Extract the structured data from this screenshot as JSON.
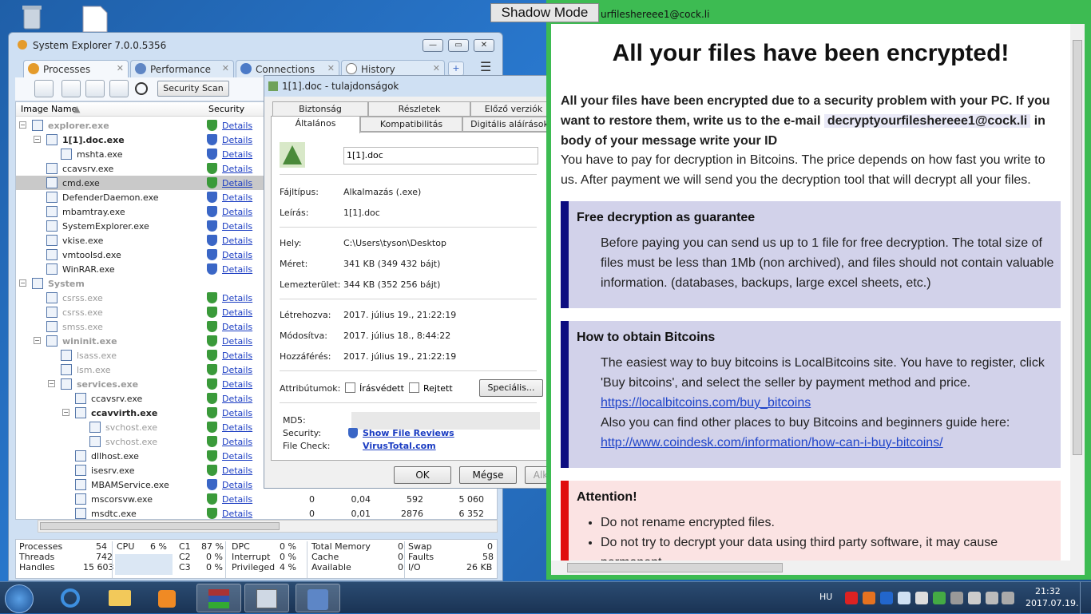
{
  "system_explorer": {
    "title": "System Explorer 7.0.0.5356",
    "tabs": [
      "Processes",
      "Performance",
      "Connections",
      "History"
    ],
    "security_scan": "Security Scan",
    "columns": {
      "image_name": "Image Name",
      "security": "Security"
    },
    "details_label": "Details",
    "processes": [
      {
        "name": "explorer.exe",
        "style": "grey-bold",
        "indent": 0,
        "tree": "−",
        "shield": "green"
      },
      {
        "name": "1[1].doc.exe",
        "style": "bold",
        "indent": 1,
        "tree": "−",
        "shield": "blue"
      },
      {
        "name": "mshta.exe",
        "style": "normal",
        "indent": 2,
        "tree": "",
        "shield": "blue"
      },
      {
        "name": "ccavsrv.exe",
        "style": "normal",
        "indent": 1,
        "tree": "",
        "shield": "green"
      },
      {
        "name": "cmd.exe",
        "style": "normal",
        "indent": 1,
        "tree": "",
        "shield": "green",
        "selected": true
      },
      {
        "name": "DefenderDaemon.exe",
        "style": "normal",
        "indent": 1,
        "tree": "",
        "shield": "blue"
      },
      {
        "name": "mbamtray.exe",
        "style": "normal",
        "indent": 1,
        "tree": "",
        "shield": "blue"
      },
      {
        "name": "SystemExplorer.exe",
        "style": "normal",
        "indent": 1,
        "tree": "",
        "shield": "blue"
      },
      {
        "name": "vkise.exe",
        "style": "normal",
        "indent": 1,
        "tree": "",
        "shield": "blue"
      },
      {
        "name": "vmtoolsd.exe",
        "style": "normal",
        "indent": 1,
        "tree": "",
        "shield": "blue"
      },
      {
        "name": "WinRAR.exe",
        "style": "normal",
        "indent": 1,
        "tree": "",
        "shield": "blue"
      },
      {
        "name": "System",
        "style": "grey-bold",
        "indent": 0,
        "tree": "−",
        "shield": ""
      },
      {
        "name": "csrss.exe",
        "style": "grey",
        "indent": 1,
        "tree": "",
        "shield": "green"
      },
      {
        "name": "csrss.exe",
        "style": "grey",
        "indent": 1,
        "tree": "",
        "shield": "green"
      },
      {
        "name": "smss.exe",
        "style": "grey",
        "indent": 1,
        "tree": "",
        "shield": "green"
      },
      {
        "name": "wininit.exe",
        "style": "grey-bold",
        "indent": 1,
        "tree": "−",
        "shield": "green"
      },
      {
        "name": "lsass.exe",
        "style": "grey",
        "indent": 2,
        "tree": "",
        "shield": "green"
      },
      {
        "name": "lsm.exe",
        "style": "grey",
        "indent": 2,
        "tree": "",
        "shield": "green"
      },
      {
        "name": "services.exe",
        "style": "grey-bold",
        "indent": 2,
        "tree": "−",
        "shield": "green"
      },
      {
        "name": "ccavsrv.exe",
        "style": "normal",
        "indent": 3,
        "tree": "",
        "shield": "green"
      },
      {
        "name": "ccavvirth.exe",
        "style": "bold",
        "indent": 3,
        "tree": "−",
        "shield": "green"
      },
      {
        "name": "svchost.exe",
        "style": "grey",
        "indent": 4,
        "tree": "",
        "shield": "green"
      },
      {
        "name": "svchost.exe",
        "style": "grey",
        "indent": 4,
        "tree": "",
        "shield": "green"
      },
      {
        "name": "dllhost.exe",
        "style": "normal",
        "indent": 3,
        "tree": "",
        "shield": "green"
      },
      {
        "name": "isesrv.exe",
        "style": "normal",
        "indent": 3,
        "tree": "",
        "shield": "green"
      },
      {
        "name": "MBAMService.exe",
        "style": "normal",
        "indent": 3,
        "tree": "",
        "shield": "blue"
      },
      {
        "name": "mscorsvw.exe",
        "style": "normal",
        "indent": 3,
        "tree": "",
        "shield": "green",
        "cols": [
          "0",
          "0,04",
          "592",
          "5 060"
        ]
      },
      {
        "name": "msdtc.exe",
        "style": "normal",
        "indent": 3,
        "tree": "",
        "shield": "green",
        "cols": [
          "0",
          "0,01",
          "2876",
          "6 352"
        ]
      }
    ],
    "status": {
      "processes_label": "Processes",
      "processes": "54",
      "threads_label": "Threads",
      "threads": "742",
      "handles_label": "Handles",
      "handles": "15 603",
      "cpu_label": "CPU",
      "cpu": "6 %",
      "c1_label": "C1",
      "c1": "87 %",
      "c2_label": "C2",
      "c2": "0 %",
      "c3_label": "C3",
      "c3": "0 %",
      "dpc_label": "DPC",
      "dpc": "0 %",
      "interrupt_label": "Interrupt",
      "interrupt": "0 %",
      "privileged_label": "Privileged",
      "privileged": "4 %",
      "total_memory_label": "Total Memory",
      "total_memory": "0",
      "cache_label": "Cache",
      "cache": "0",
      "available_label": "Available",
      "available": "0",
      "swap_label": "Swap",
      "swap": "0",
      "faults_label": "Faults",
      "faults": "58",
      "io_label": "I/O",
      "io": "26 KB"
    }
  },
  "properties": {
    "title": "1[1].doc - tulajdonságok",
    "tabs_row1": [
      "Biztonság",
      "Részletek",
      "Előző verziók"
    ],
    "tabs_row2": [
      "Általános",
      "Kompatibilitás",
      "Digitális aláírások"
    ],
    "file_name": "1[1].doc",
    "fields": [
      {
        "label": "Fájltípus:",
        "value": "Alkalmazás (.exe)"
      },
      {
        "label": "Leírás:",
        "value": "1[1].doc"
      },
      {
        "label": "Hely:",
        "value": "C:\\Users\\tyson\\Desktop"
      },
      {
        "label": "Méret:",
        "value": "341 KB (349 432 bájt)"
      },
      {
        "label": "Lemezterület:",
        "value": "344 KB (352 256 bájt)"
      },
      {
        "label": "Létrehozva:",
        "value": "2017. július 19., 21:22:19"
      },
      {
        "label": "Módosítva:",
        "value": "2017. július 18., 8:44:22"
      },
      {
        "label": "Hozzáférés:",
        "value": "2017. július 19., 21:22:19"
      }
    ],
    "attributes_label": "Attribútumok:",
    "readonly_label": "Írásvédett",
    "hidden_label": "Rejtett",
    "special_button": "Speciális...",
    "md5_label": "MD5:",
    "security_label": "Security:",
    "security_link": "Show File Reviews",
    "filecheck_label": "File Check:",
    "filecheck_link": "VirusTotal.com",
    "ok": "OK",
    "cancel": "Mégse",
    "apply": "Alk"
  },
  "ransom": {
    "shadow_mode": "Shadow Mode",
    "url_fragment": "urfileshereee1@cock.li",
    "title": "All your files have been encrypted!",
    "intro_bold_1": "All your files have been encrypted due to a security problem with your PC. If you want to restore them, write us to the e-mail",
    "email": "decryptyourfileshereee1@cock.li",
    "intro_bold_2": "in body of your message write your ID",
    "intro_normal": "You have to pay for decryption in Bitcoins. The price depends on how fast you write to us. After payment we will send you the decryption tool that will decrypt all your files.",
    "free_title": "Free decryption as guarantee",
    "free_body": "Before paying you can send us up to 1 file for free decryption. The total size of files must be less than 1Mb (non archived), and files should not contain valuable information. (databases, backups, large excel sheets, etc.)",
    "bitcoin_title": "How to obtain Bitcoins",
    "bitcoin_body": "The easiest way to buy bitcoins is LocalBitcoins site. You have to register, click 'Buy bitcoins', and select the seller by payment method and price.",
    "bitcoin_link1": "https://localbitcoins.com/buy_bitcoins",
    "bitcoin_body2": "Also you can find other places to buy Bitcoins and beginners guide here:",
    "bitcoin_link2": "http://www.coindesk.com/information/how-can-i-buy-bitcoins/",
    "attention_title": "Attention!",
    "attention_items": [
      "Do not rename encrypted files.",
      "Do not try to decrypt your data using third party software, it may cause permanent"
    ]
  },
  "taskbar": {
    "lang": "HU",
    "time": "21:32",
    "date": "2017.07.19."
  }
}
